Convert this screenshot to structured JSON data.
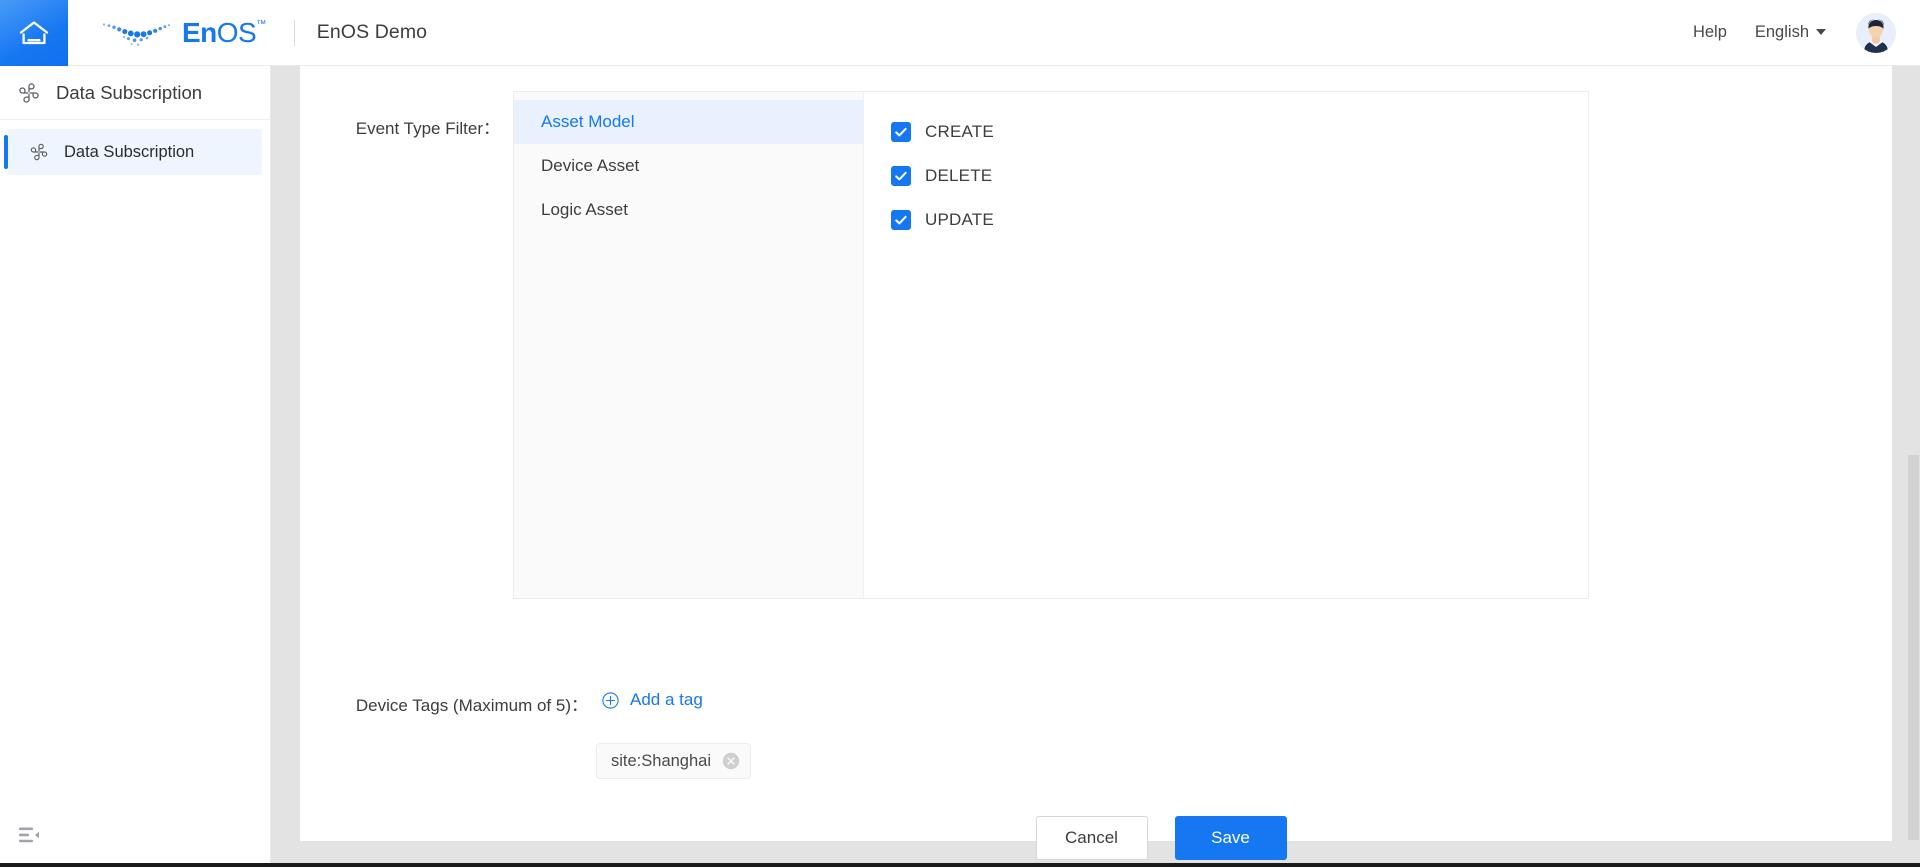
{
  "header": {
    "home_icon": "home-icon",
    "logo_mark": "enos-dots-logo",
    "logo_text_bold": "En",
    "logo_text_thin": "OS",
    "logo_tm": "™",
    "app_title": "EnOS Demo",
    "help_label": "Help",
    "language_label": "English",
    "language_caret": "chevron-down-icon",
    "avatar": "user-avatar"
  },
  "sidebar": {
    "title": "Data Subscription",
    "title_icon": "pinwheel-icon",
    "items": [
      {
        "label": "Data Subscription",
        "icon": "pinwheel-icon",
        "active": true
      }
    ],
    "collapse_icon": "menu-fold-icon"
  },
  "form": {
    "filter_label": "Event Type Filter：",
    "asset_types": [
      {
        "label": "Asset Model",
        "selected": true
      },
      {
        "label": "Device Asset",
        "selected": false
      },
      {
        "label": "Logic Asset",
        "selected": false
      }
    ],
    "event_types": [
      {
        "label": "CREATE",
        "checked": true
      },
      {
        "label": "DELETE",
        "checked": true
      },
      {
        "label": "UPDATE",
        "checked": true
      }
    ],
    "tags_label": "Device Tags (Maximum of 5)：",
    "add_tag_label": "Add a tag",
    "add_tag_icon": "plus-circle-icon",
    "tags": [
      {
        "label": "site:Shanghai",
        "close_icon": "close-circle-icon"
      }
    ],
    "cancel_label": "Cancel",
    "save_label": "Save"
  },
  "colors": {
    "accent": "#1677f2",
    "selected_row_bg": "#e9f1fe",
    "page_bg": "#e3e3e3",
    "panel_bg": "#fafafa",
    "text": "#3d3d3d",
    "border": "#ececec"
  },
  "scrollbar": {
    "name": "page-vertical-scrollbar"
  }
}
